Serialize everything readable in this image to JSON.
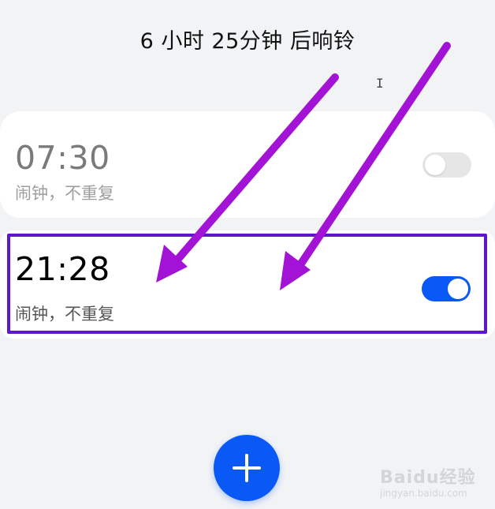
{
  "header": {
    "countdown": "6 小时  25分钟 后响铃"
  },
  "alarms": [
    {
      "time": "07:30",
      "subtitle": "闹钟，不重复",
      "enabled": false
    },
    {
      "time": "21:28",
      "subtitle": "闹钟，不重复",
      "enabled": true
    }
  ],
  "fab": {
    "icon": "plus-icon"
  },
  "watermark": {
    "brand": "Baidu经验",
    "url": "jingyan.baidu.com"
  },
  "colors": {
    "accent": "#0a59f7",
    "highlight_border": "#5b17c9",
    "annotation_arrow": "#a313d6",
    "background": "#f1f3f5"
  }
}
